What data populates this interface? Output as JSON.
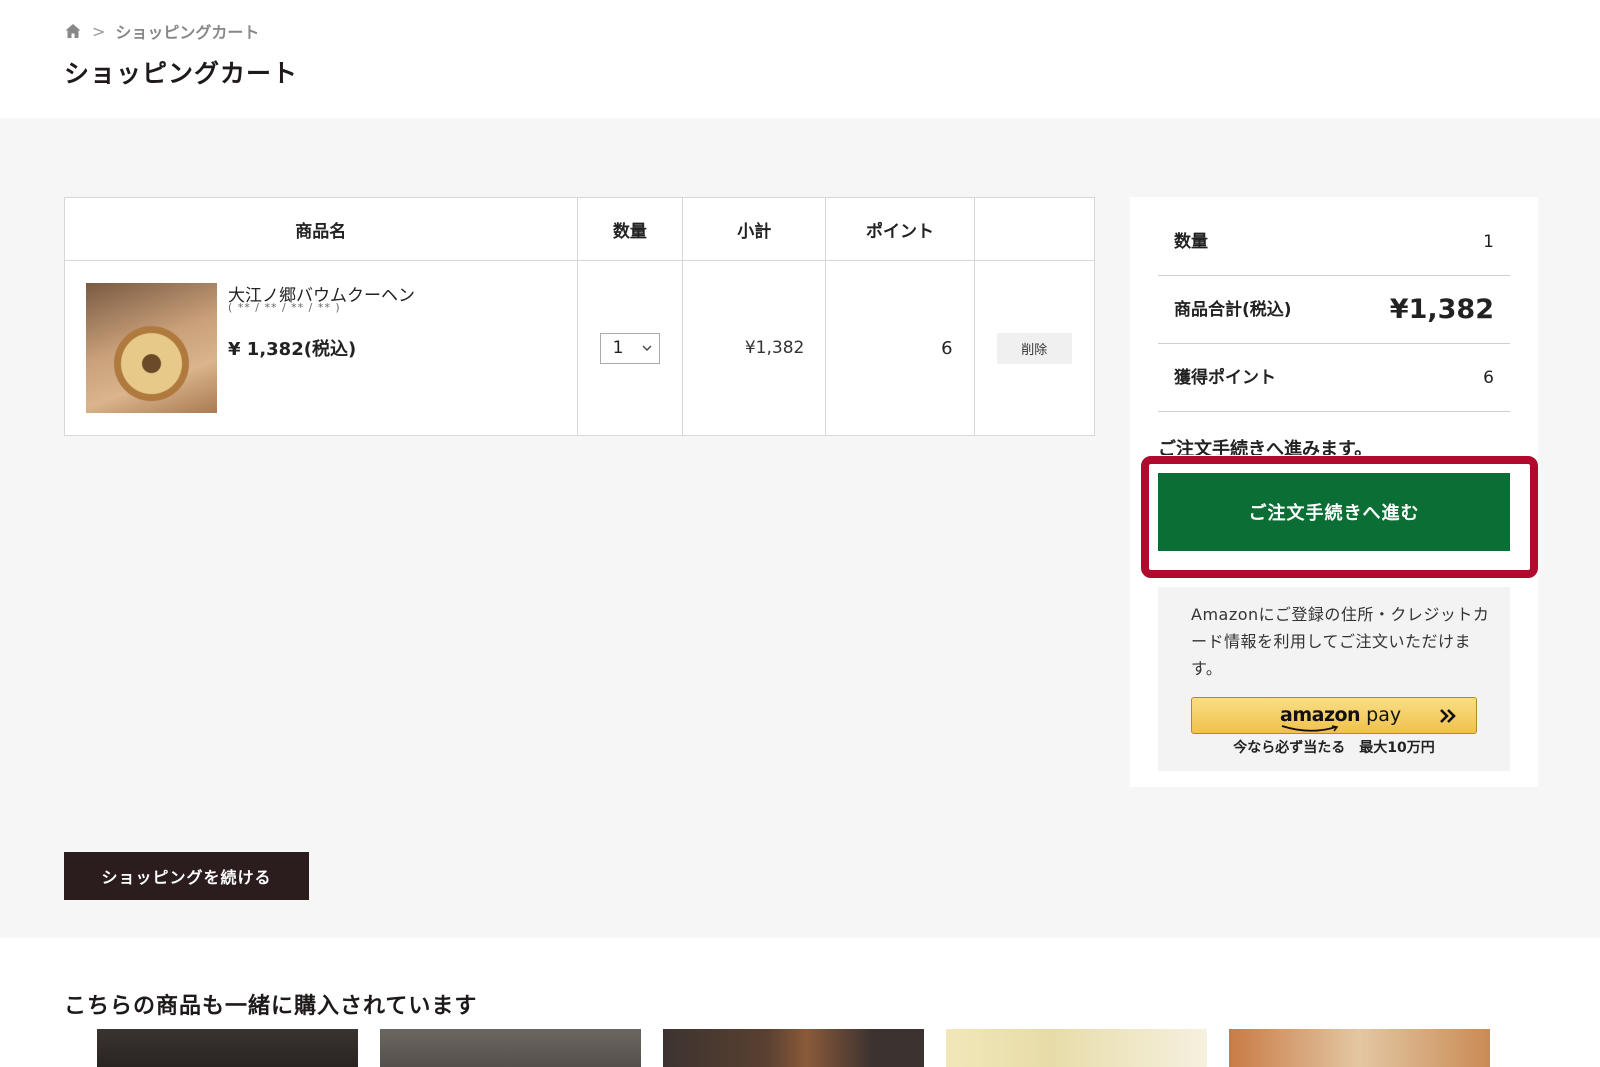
{
  "breadcrumb": {
    "home_icon": "home-icon",
    "separator": ">",
    "current": "ショッピングカート"
  },
  "page_title": "ショッピングカート",
  "cart_table": {
    "headers": [
      "商品名",
      "数量",
      "小計",
      "ポイント",
      ""
    ],
    "items": [
      {
        "name": "大江ノ郷バウムクーヘン",
        "date_placeholder": "( ** / ** / ** / ** )",
        "price": "¥ 1,382(税込)",
        "quantity": "1",
        "subtotal": "¥1,382",
        "points": "6",
        "delete_label": "削除"
      }
    ]
  },
  "summary": {
    "quantity_label": "数量",
    "quantity_value": "1",
    "total_label": "商品合計(税込)",
    "total_value": "¥1,382",
    "points_label": "獲得ポイント",
    "points_value": "6",
    "notice": "ご注文手続きへ進みます。",
    "checkout_label": "ご注文手続きへ進む",
    "highlight_color": "#b00a2e",
    "checkout_color": "#0b6e35"
  },
  "amazon_pay": {
    "description": "Amazonにご登録の住所・クレジットカード情報を利用してご注文いただけます。",
    "logo_amazon": "amazon",
    "logo_pay": "pay",
    "promo": "今なら必ず当たる　最大10万円"
  },
  "continue_label": "ショッピングを続ける",
  "recommendations": {
    "heading": "こちらの商品も一緒に購入されています",
    "thumbnail_count": 5
  }
}
